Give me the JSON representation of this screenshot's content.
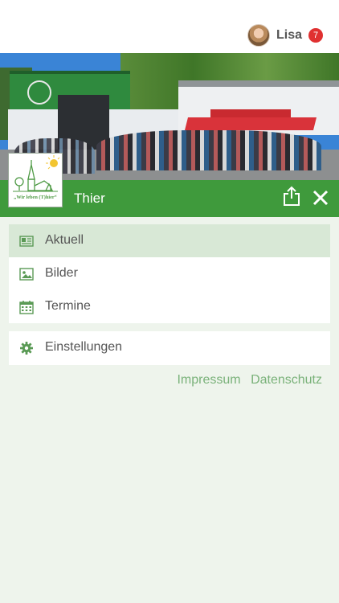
{
  "header": {
    "user_name": "Lisa",
    "notification_count": "7"
  },
  "group": {
    "name": "Thier",
    "logo_text": "„Wir leben (T)hier“"
  },
  "menu": {
    "items": [
      {
        "label": "Aktuell",
        "icon": "newspaper-icon",
        "active": true
      },
      {
        "label": "Bilder",
        "icon": "image-icon",
        "active": false
      },
      {
        "label": "Termine",
        "icon": "calendar-icon",
        "active": false
      }
    ],
    "settings_label": "Einstellungen"
  },
  "footer": {
    "impressum": "Impressum",
    "datenschutz": "Datenschutz"
  },
  "colors": {
    "brand_green": "#3f9a3c",
    "active_bg": "#d8e8d6",
    "link_green": "#7ab27a",
    "badge_red": "#e03030"
  }
}
